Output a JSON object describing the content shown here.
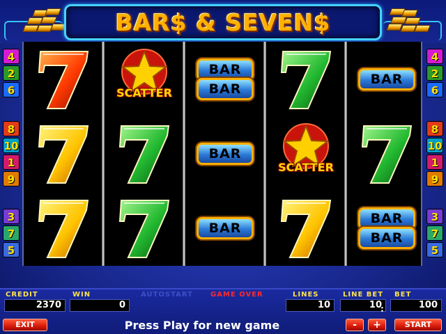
{
  "header": {
    "title": "BAR$ & SEVEN$"
  },
  "colors": {
    "seven_red": "#ff3a00",
    "seven_yellow": "#ffd000",
    "seven_green": "#22b830",
    "title_gold": "#ffb000",
    "bar_blue": "#2a7ad8",
    "button_red": "#d81a0a"
  },
  "line_numbers": {
    "left": [
      "4",
      "2",
      "6",
      "8",
      "10",
      "1",
      "9",
      "3",
      "7",
      "5"
    ],
    "right": [
      "4",
      "2",
      "6",
      "8",
      "10",
      "1",
      "9",
      "3",
      "7",
      "5"
    ]
  },
  "reels": [
    {
      "symbols": [
        {
          "type": "seven",
          "color": "red"
        },
        {
          "type": "seven",
          "color": "yellow"
        },
        {
          "type": "seven",
          "color": "yellow"
        }
      ]
    },
    {
      "symbols": [
        {
          "type": "scatter",
          "label": "SCATTER"
        },
        {
          "type": "seven",
          "color": "green"
        },
        {
          "type": "seven",
          "color": "green"
        }
      ]
    },
    {
      "symbols": [
        {
          "type": "double_bar",
          "label": "BAR"
        },
        {
          "type": "bar",
          "label": "BAR"
        },
        {
          "type": "bar",
          "label": "BAR"
        }
      ]
    },
    {
      "symbols": [
        {
          "type": "seven",
          "color": "green"
        },
        {
          "type": "scatter",
          "label": "SCATTER"
        },
        {
          "type": "seven",
          "color": "yellow"
        }
      ]
    },
    {
      "symbols": [
        {
          "type": "bar",
          "label": "BAR"
        },
        {
          "type": "seven",
          "color": "green"
        },
        {
          "type": "double_bar",
          "label": "BAR"
        }
      ]
    }
  ],
  "panel": {
    "credit_label": "CREDIT",
    "credit_value": "2370",
    "win_label": "WIN",
    "win_value": "0",
    "autostart_label": "AUTOSTART",
    "game_over_label": "GAME OVER",
    "lines_label": "LINES",
    "lines_value": "10",
    "line_bet_label": "LINE BET",
    "line_bet_value": "10",
    "bet_label": "BET",
    "bet_value": "100",
    "exit_label": "EXIT",
    "minus_label": "-",
    "plus_label": "+",
    "start_label": "START",
    "message": "Press Play for new game"
  }
}
